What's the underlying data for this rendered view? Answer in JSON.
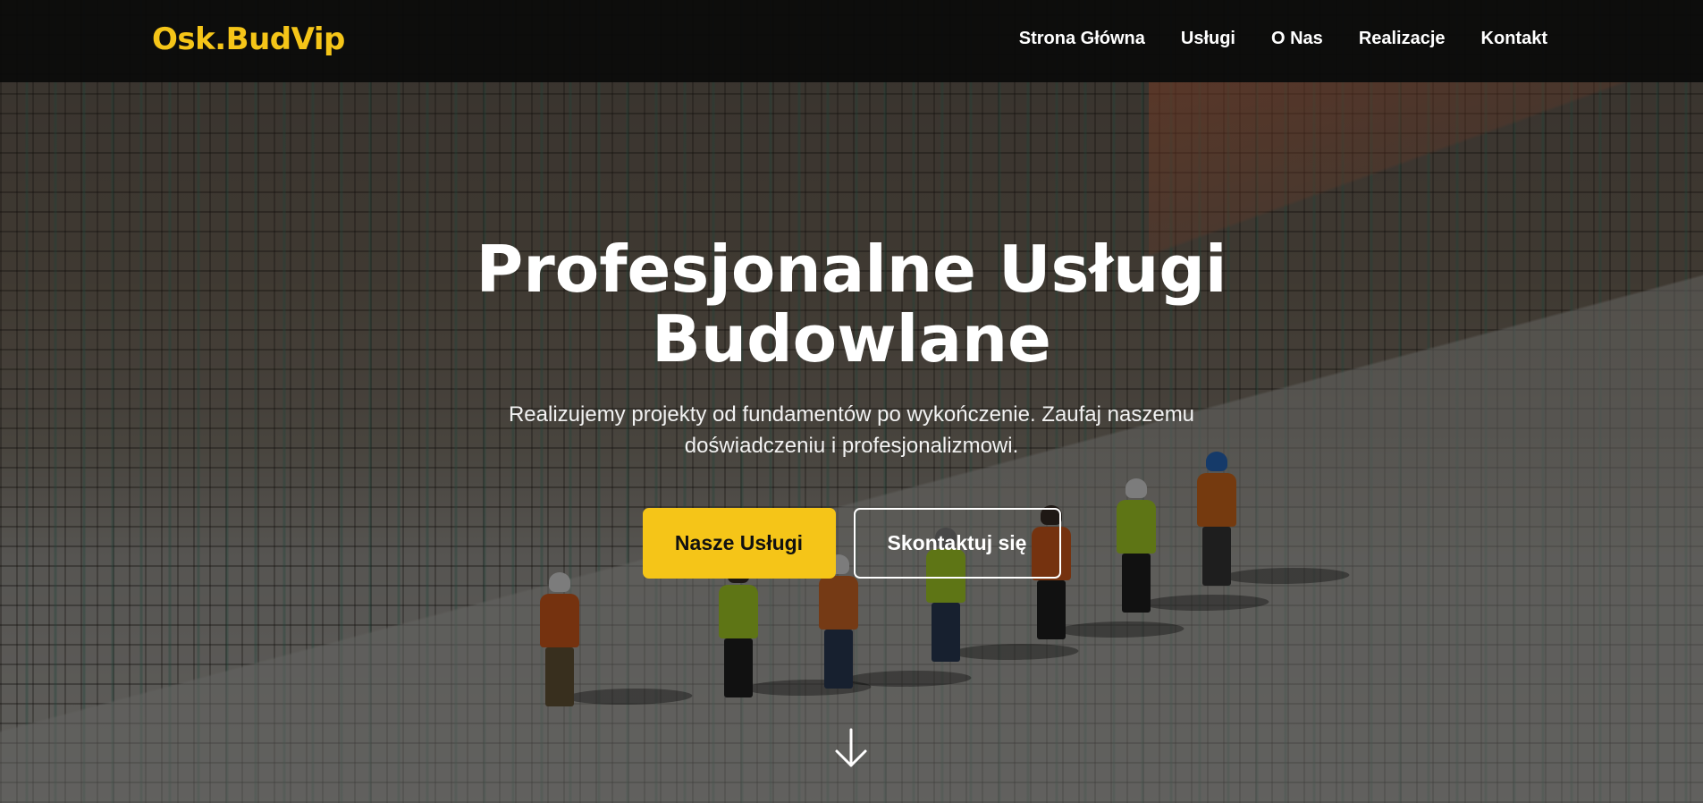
{
  "header": {
    "logo": "Osk.BudVip",
    "nav": [
      {
        "label": "Strona Główna"
      },
      {
        "label": "Usługi"
      },
      {
        "label": "O Nas"
      },
      {
        "label": "Realizacje"
      },
      {
        "label": "Kontakt"
      }
    ]
  },
  "hero": {
    "title": "Profesjonalne Usługi Budowlane",
    "subtitle": "Realizujemy projekty od fundamentów po wykończenie. Zaufaj naszemu doświadczeniu i profesjonalizmowi.",
    "primary_button": "Nasze Usługi",
    "secondary_button": "Skontaktuj się",
    "scroll_icon": "arrow-down-icon"
  },
  "colors": {
    "accent": "#f5c518",
    "navbar": "#0a0a0a",
    "text": "#ffffff"
  }
}
